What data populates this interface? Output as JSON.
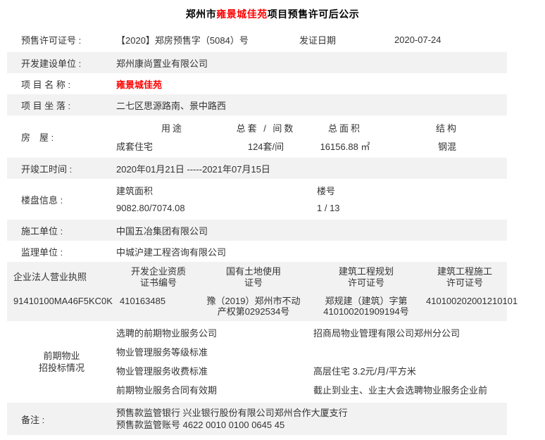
{
  "title": {
    "prefix": "郑州市",
    "project": "雍景城佳苑",
    "suffix": "项目预售许可后公示"
  },
  "colors": {
    "accent_red": "#ff0000",
    "stripe_gray": "#f2f2f2",
    "text": "#333333"
  },
  "permit_row": {
    "label": "预售许可证号 :",
    "number": "【2020】郑房预售字（5084）号",
    "date_label": "发证日期",
    "date": "2020-07-24"
  },
  "developer_row": {
    "label": "开发建设单位 :",
    "value": "郑州康尚置业有限公司"
  },
  "name_row": {
    "label": "项 目 名 称 :",
    "value": "雍景城佳苑"
  },
  "location_row": {
    "label": "项 目 坐 落 :",
    "value": "二七区思源路南、景中路西"
  },
  "house_row": {
    "label": "房　屋 :",
    "columns": [
      "用途",
      "总套 / 间数",
      "总面积",
      "结构"
    ],
    "values": [
      "成套住宅",
      "124套/间",
      "16156.88 ㎡",
      "钢混"
    ]
  },
  "schedule_row": {
    "label": "开竣工时间 :",
    "value": "2020年01月21日 -----2021年07月15日"
  },
  "building_row": {
    "label": "楼盘信息 :",
    "area_label": "建筑面积",
    "area_value": "9082.80/7074.08",
    "number_label": "楼号",
    "number_value": "1 / 13"
  },
  "constructor_row": {
    "label": "施工单位 :",
    "value": "中国五冶集团有限公司"
  },
  "supervisor_row": {
    "label": "监理单位 :",
    "value": "中城沪建工程咨询有限公司"
  },
  "license_row": {
    "headers": [
      {
        "l1": "企业法人营业执照",
        "l2": ""
      },
      {
        "l1": "开发企业资质",
        "l2": "证书编号"
      },
      {
        "l1": "国有土地使用",
        "l2": "证号"
      },
      {
        "l1": "建筑工程规划",
        "l2": "许可证号"
      },
      {
        "l1": "建筑工程施工",
        "l2": "许可证号"
      }
    ],
    "values": [
      "91410100MA46F5KC0K",
      "410163485",
      "豫（2019）郑州市不动产权第0292534号",
      "郑规建（建筑）字第410100201909194号",
      "410100202001210101"
    ]
  },
  "property_row": {
    "label_line1": "前期物业",
    "label_line2": "招投标情况",
    "items": [
      {
        "name": "选聘的前期物业服务公司",
        "value": "招商局物业管理有限公司郑州分公司"
      },
      {
        "name": "物业管理服务等级标准",
        "value": ""
      },
      {
        "name": "物业管理服务收费标准",
        "value": "高层住宅 3.2元/月/平方米"
      },
      {
        "name": "前期物业服务合同有效期",
        "value": "截止到业主、业主大会选聘物业服务企业前"
      }
    ]
  },
  "remark_row": {
    "label": "备注 :",
    "line1": "预售款监管银行 兴业银行股份有限公司郑州合作大厦支行",
    "line2": "预售款监管账号 4622 0010 0100 0645 45"
  }
}
